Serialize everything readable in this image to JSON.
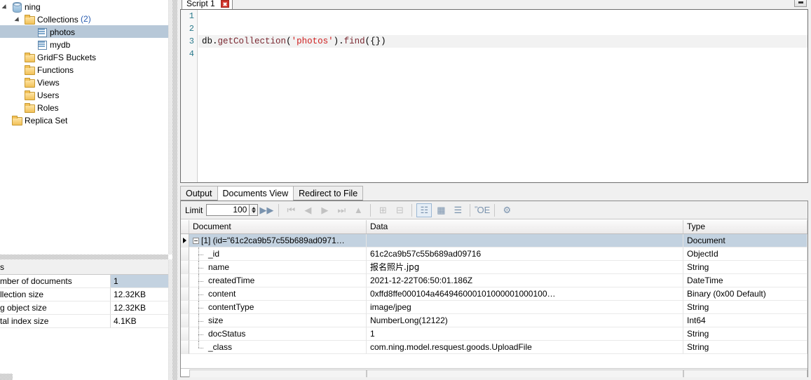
{
  "sidebar": {
    "tree": [
      {
        "label": "ning",
        "icon": "database-icon",
        "indent": 0,
        "twisty": "open",
        "selected": false,
        "type": "database"
      },
      {
        "label": "Collections",
        "suffix": "(2)",
        "icon": "folder-icon",
        "indent": 1,
        "twisty": "open",
        "selected": false,
        "type": "folder"
      },
      {
        "label": "photos",
        "icon": "collection-icon",
        "indent": 2,
        "twisty": "none",
        "selected": true,
        "type": "collection"
      },
      {
        "label": "mydb",
        "icon": "collection-icon",
        "indent": 2,
        "twisty": "none",
        "selected": false,
        "type": "collection"
      },
      {
        "label": "GridFS Buckets",
        "icon": "folder-icon",
        "indent": 1,
        "twisty": "none",
        "selected": false,
        "type": "folder"
      },
      {
        "label": "Functions",
        "icon": "folder-icon",
        "indent": 1,
        "twisty": "none",
        "selected": false,
        "type": "folder"
      },
      {
        "label": "Views",
        "icon": "folder-icon",
        "indent": 1,
        "twisty": "none",
        "selected": false,
        "type": "folder"
      },
      {
        "label": "Users",
        "icon": "folder-icon",
        "indent": 1,
        "twisty": "none",
        "selected": false,
        "type": "folder"
      },
      {
        "label": "Roles",
        "icon": "folder-icon",
        "indent": 1,
        "twisty": "none",
        "selected": false,
        "type": "folder"
      },
      {
        "label": "Replica Set",
        "icon": "folder-icon",
        "indent": 0,
        "twisty": "none",
        "selected": false,
        "type": "folder"
      }
    ],
    "stats": {
      "title": "s",
      "rows": [
        {
          "key": "mber of documents",
          "value": "1",
          "selected": true
        },
        {
          "key": "llection size",
          "value": "12.32KB",
          "selected": false
        },
        {
          "key": "g object size",
          "value": "12.32KB",
          "selected": false
        },
        {
          "key": "tal index size",
          "value": "4.1KB",
          "selected": false
        }
      ]
    }
  },
  "editor": {
    "tab_label": "Script 1",
    "line_numbers": [
      "1",
      "2",
      "3",
      "4"
    ],
    "active_line": 3,
    "code_tokens": [
      {
        "text": "db",
        "kind": "id"
      },
      {
        "text": ".",
        "kind": "punct"
      },
      {
        "text": "getCollection",
        "kind": "fn"
      },
      {
        "text": "(",
        "kind": "punct"
      },
      {
        "text": "'photos'",
        "kind": "str"
      },
      {
        "text": ")",
        "kind": "punct"
      },
      {
        "text": ".",
        "kind": "punct"
      },
      {
        "text": "find",
        "kind": "fn"
      },
      {
        "text": "({})",
        "kind": "punct"
      }
    ],
    "code_plain": "db.getCollection('photos').find({})"
  },
  "result": {
    "tabs": [
      {
        "label": "Output",
        "active": false
      },
      {
        "label": "Documents View",
        "active": true
      },
      {
        "label": "Redirect to File",
        "active": false
      }
    ],
    "toolbar": {
      "limit_label": "Limit",
      "limit_value": "100",
      "buttons": [
        {
          "name": "run-next-batch-icon",
          "glyph": "▶▶",
          "enabled": true
        },
        {
          "name": "first-page-icon",
          "glyph": "⏮",
          "enabled": false
        },
        {
          "name": "previous-page-icon",
          "glyph": "◀",
          "enabled": false
        },
        {
          "name": "next-page-icon",
          "glyph": "▶",
          "enabled": false
        },
        {
          "name": "last-page-icon",
          "glyph": "⏭",
          "enabled": false
        },
        {
          "name": "scroll-top-icon",
          "glyph": "▲",
          "enabled": false
        },
        {
          "name": "expand-all-icon",
          "glyph": "⊞",
          "enabled": false
        },
        {
          "name": "collapse-all-icon",
          "glyph": "⊟",
          "enabled": false
        },
        {
          "name": "tree-view-icon",
          "glyph": "☷",
          "enabled": true,
          "selected": true
        },
        {
          "name": "table-view-icon",
          "glyph": "▦",
          "enabled": true
        },
        {
          "name": "json-view-icon",
          "glyph": "☰",
          "enabled": true
        },
        {
          "name": "export-icon",
          "glyph": "ὋE",
          "enabled": true
        },
        {
          "name": "settings-gear-icon",
          "glyph": "⚙",
          "enabled": true
        }
      ]
    },
    "columns": [
      "Document",
      "Data",
      "Type"
    ],
    "rows": [
      {
        "document": "[1] (id=\"61c2ca9b57c55b689ad0971…",
        "data": "",
        "type": "Document",
        "level": 0,
        "selected": true,
        "expanded": true
      },
      {
        "document": "_id",
        "data": "61c2ca9b57c55b689ad09716",
        "type": "ObjectId",
        "level": 1,
        "selected": false
      },
      {
        "document": "name",
        "data": "报名照片.jpg",
        "type": "String",
        "level": 1,
        "selected": false,
        "cjk": true
      },
      {
        "document": "createdTime",
        "data": "2021-12-22T06:50:01.186Z",
        "type": "DateTime",
        "level": 1,
        "selected": false
      },
      {
        "document": "content",
        "data": "0xffd8ffe000104a464946000101000001000100…",
        "type": "Binary (0x00 Default)",
        "level": 1,
        "selected": false
      },
      {
        "document": "contentType",
        "data": "image/jpeg",
        "type": "String",
        "level": 1,
        "selected": false
      },
      {
        "document": "size",
        "data": "NumberLong(12122)",
        "type": "Int64",
        "level": 1,
        "selected": false
      },
      {
        "document": "docStatus",
        "data": "1",
        "type": "String",
        "level": 1,
        "selected": false
      },
      {
        "document": "_class",
        "data": "com.ning.model.resquest.goods.UploadFile",
        "type": "String",
        "level": 1,
        "selected": false
      }
    ]
  },
  "colors": {
    "selection": "#c3d2e0",
    "tree_selection": "#b7c8d8",
    "string_literal": "#d02020",
    "function_name": "#7a2730",
    "line_number": "#2a7a8c",
    "count_link": "#2a5db0",
    "close_button": "#d0342c"
  }
}
